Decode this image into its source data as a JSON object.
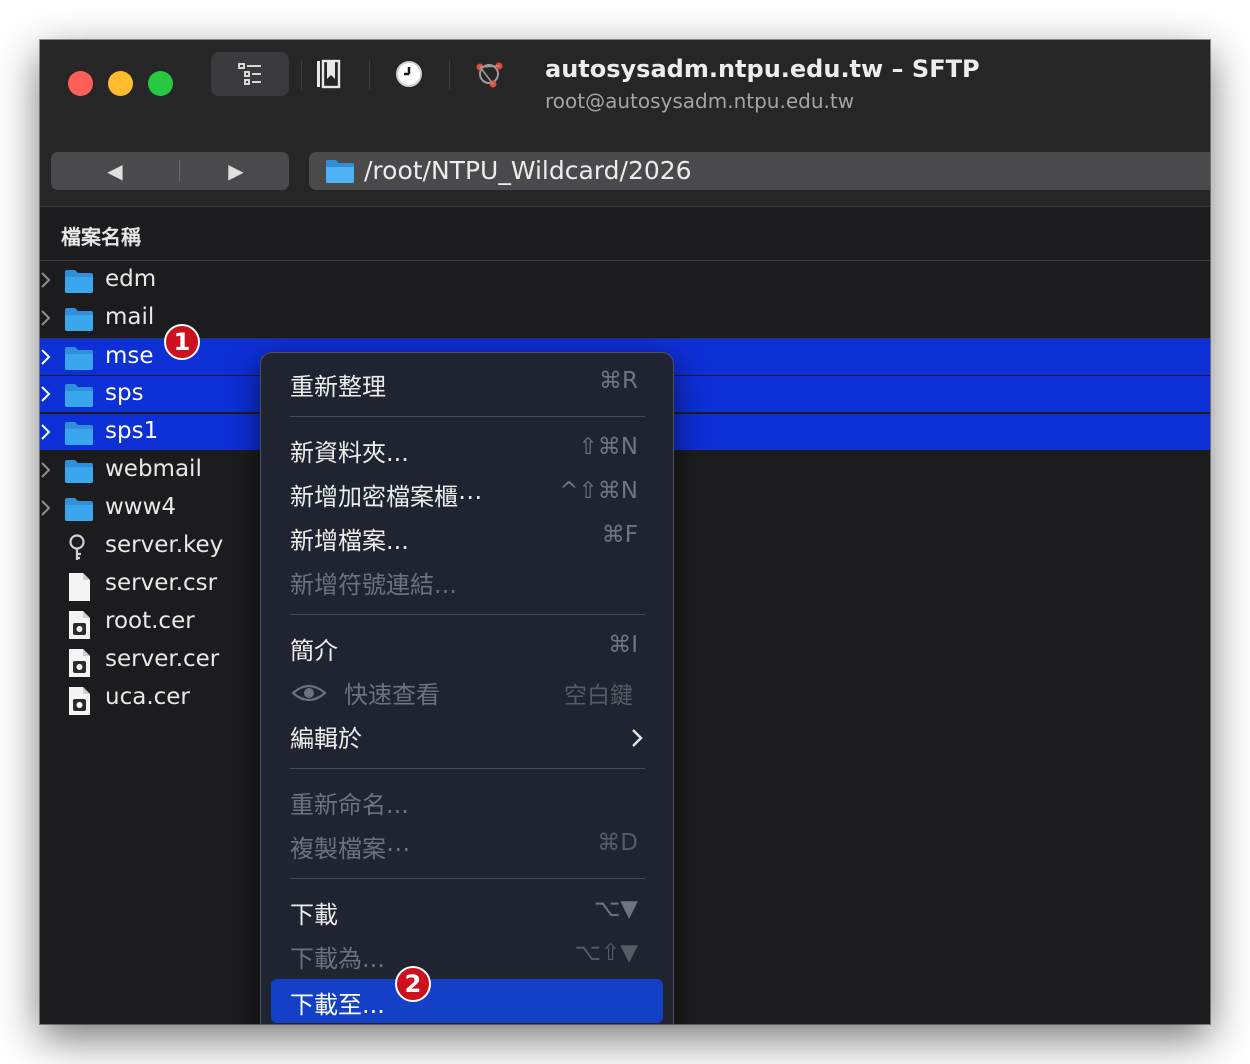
{
  "window": {
    "title": "autosysadm.ntpu.edu.tw – SFTP",
    "subtitle": "root@autosysadm.ntpu.edu.tw"
  },
  "toolbar": {
    "outline_icon": "outline-view-icon",
    "bookmark_icon": "bookmarks-icon",
    "history_icon": "history-clock-icon",
    "connection_icon": "connection-icon"
  },
  "nav": {
    "back": "◀",
    "forward": "▶",
    "path": "/root/NTPU_Wildcard/2026"
  },
  "browser": {
    "column_header": "檔案名稱"
  },
  "files": [
    {
      "name": "edm",
      "type": "folder",
      "selected": false
    },
    {
      "name": "mail",
      "type": "folder",
      "selected": false
    },
    {
      "name": "mse",
      "type": "folder",
      "selected": true
    },
    {
      "name": "sps",
      "type": "folder",
      "selected": true
    },
    {
      "name": "sps1",
      "type": "folder",
      "selected": true
    },
    {
      "name": "webmail",
      "type": "folder",
      "selected": false
    },
    {
      "name": "www4",
      "type": "folder",
      "selected": false
    },
    {
      "name": "server.key",
      "type": "key",
      "selected": false
    },
    {
      "name": "server.csr",
      "type": "document",
      "selected": false
    },
    {
      "name": "root.cer",
      "type": "certificate",
      "selected": false
    },
    {
      "name": "server.cer",
      "type": "certificate",
      "selected": false
    },
    {
      "name": "uca.cer",
      "type": "certificate",
      "selected": false
    }
  ],
  "badges": {
    "step1": "1",
    "step2": "2"
  },
  "context_menu": {
    "refresh": {
      "label": "重新整理",
      "shortcut": "⌘R"
    },
    "new_folder": {
      "label": "新資料夾...",
      "shortcut": "⇧⌘N"
    },
    "new_encrypted_vault": {
      "label": "新增加密檔案櫃⋯",
      "shortcut": "^⇧⌘N"
    },
    "new_file": {
      "label": "新增檔案...",
      "shortcut": "⌘F"
    },
    "new_symlink": {
      "label": "新增符號連結...",
      "shortcut": ""
    },
    "info": {
      "label": "簡介",
      "shortcut": "⌘I"
    },
    "quick_look": {
      "label": "快速查看",
      "shortcut": "空白鍵"
    },
    "edit_with": {
      "label": "編輯於",
      "shortcut": ""
    },
    "rename": {
      "label": "重新命名...",
      "shortcut": ""
    },
    "duplicate": {
      "label": "複製檔案⋯",
      "shortcut": "⌘D"
    },
    "download": {
      "label": "下載",
      "shortcut": "⌥▼"
    },
    "download_as": {
      "label": "下載為...",
      "shortcut": "⌥⇧▼"
    },
    "download_to": {
      "label": "下載至...",
      "shortcut": ""
    }
  },
  "colors": {
    "selection": "#0d2fd6",
    "menu_highlight": "#1440c8",
    "folder_blue": "#3aa6ee",
    "badge_red": "#cc1020"
  }
}
